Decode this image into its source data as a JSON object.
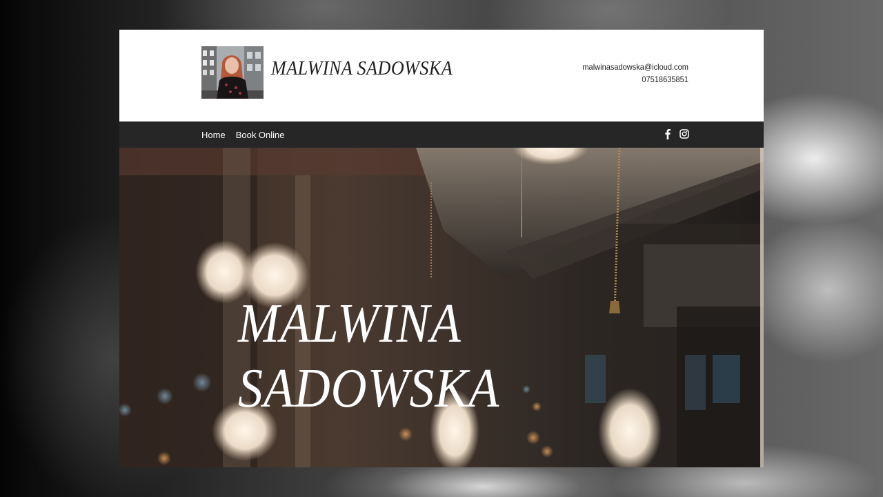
{
  "site": {
    "brand_name": "MALWINA SADOWSKA",
    "contact": {
      "email": "malwinasadowska@icloud.com",
      "phone": "07518635851"
    }
  },
  "nav": {
    "items": [
      {
        "label": "Home"
      },
      {
        "label": "Book Online"
      }
    ],
    "social": [
      {
        "icon": "facebook-icon"
      },
      {
        "icon": "instagram-icon"
      }
    ]
  },
  "hero": {
    "title_line1": "MALWINA",
    "title_line2": "SADOWSKA"
  },
  "colors": {
    "navbar": "#262626",
    "header_bg": "#ffffff",
    "text_dark": "#1f1f1f",
    "hero_text": "#ffffff"
  }
}
